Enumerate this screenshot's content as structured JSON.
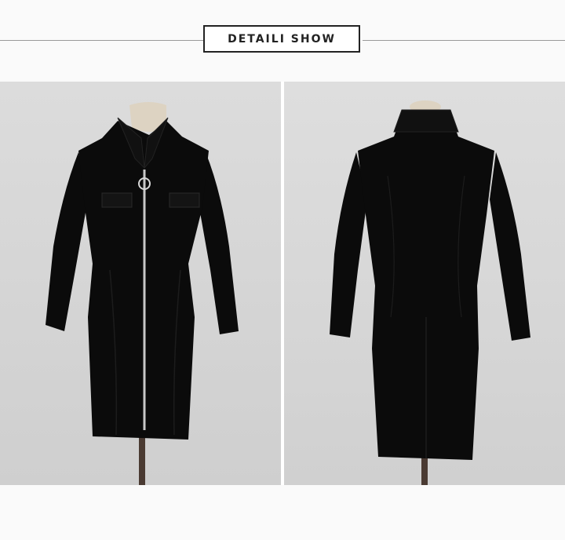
{
  "header": {
    "title": "DETAILI SHOW"
  },
  "photos": [
    {
      "view": "front",
      "subject": "dress-on-mannequin"
    },
    {
      "view": "back",
      "subject": "dress-on-mannequin"
    }
  ],
  "colors": {
    "dress": "#0b0b0b",
    "backdrop": "#d6d6d6",
    "mannequin": "#ddd3c2",
    "zipper": "#c8c8c8",
    "stand": "#4a3a32"
  }
}
